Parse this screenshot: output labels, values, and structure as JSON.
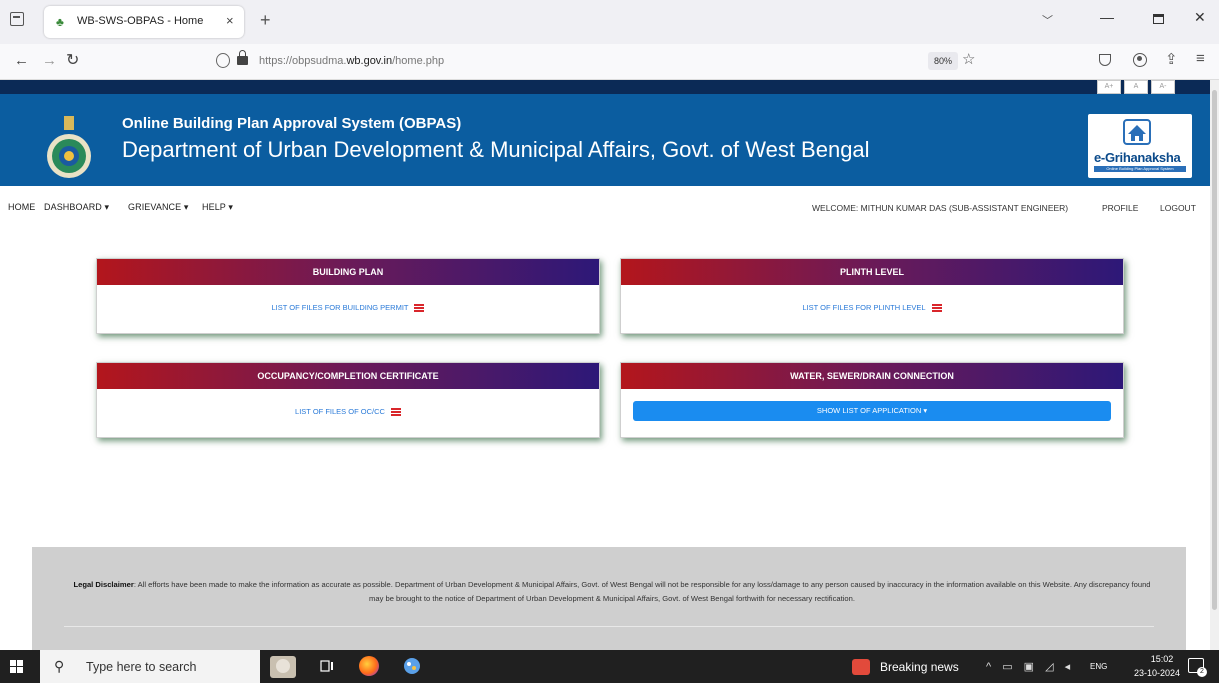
{
  "browser": {
    "tab_title": "WB-SWS-OBPAS - Home",
    "tab_close": "×",
    "new_tab": "+",
    "url_prefix": "https://obpsudma.",
    "url_domain": "wb.gov.in",
    "url_suffix": "/home.php",
    "zoom": "80%"
  },
  "header": {
    "font_controls": [
      "A+",
      "A",
      "A-"
    ],
    "title": "Online Building Plan Approval System (OBPAS)",
    "subtitle": "Department of Urban Development & Municipal Affairs, Govt. of West Bengal",
    "brand_name": "e-Grihanaksha",
    "brand_tag": "Online Building Plan Approval System",
    "colors": {
      "top_strip": "#0b2a56",
      "banner": "#0b5da0"
    }
  },
  "menu": {
    "home": "HOME",
    "dashboard": "DASHBOARD ▾",
    "grievance": "GRIEVANCE ▾",
    "help": "HELP ▾",
    "welcome": "WELCOME: MITHUN KUMAR DAS (SUB-ASSISTANT ENGINEER)",
    "profile": "PROFILE",
    "logout": "LOGOUT"
  },
  "cards": {
    "building_plan": {
      "title": "BUILDING PLAN",
      "link": "LIST OF FILES FOR BUILDING PERMIT"
    },
    "plinth_level": {
      "title": "PLINTH LEVEL",
      "link": "LIST OF FILES FOR PLINTH LEVEL"
    },
    "occupancy": {
      "title": "OCCUPANCY/COMPLETION CERTIFICATE",
      "link": "LIST OF FILES OF OC/CC"
    },
    "water": {
      "title": "WATER, SEWER/DRAIN CONNECTION",
      "button": "SHOW LIST OF APPLICATION ▾"
    },
    "colors": {
      "gradient_start": "#b3161c",
      "gradient_end": "#2d1878",
      "link": "#2a7ad8",
      "button": "#1a8cf0",
      "list_icon": "#d9262b"
    }
  },
  "footer": {
    "disclaimer_label": "Legal Disclaimer",
    "disclaimer_text": ": All efforts have been made to make the information as accurate as possible. Department of Urban Development & Municipal Affairs, Govt. of West Bengal will not be responsible for any loss/damage to any person caused by inaccuracy in the information available on this Website. Any discrepancy found may be brought to the notice of Department of Urban Development & Municipal Affairs, Govt. of West Bengal forthwith for necessary rectification."
  },
  "taskbar": {
    "search_placeholder": "Type here to search",
    "news": "Breaking news",
    "lang": "ENG",
    "time": "15:02",
    "date": "23-10-2024",
    "notification_count": "2"
  }
}
